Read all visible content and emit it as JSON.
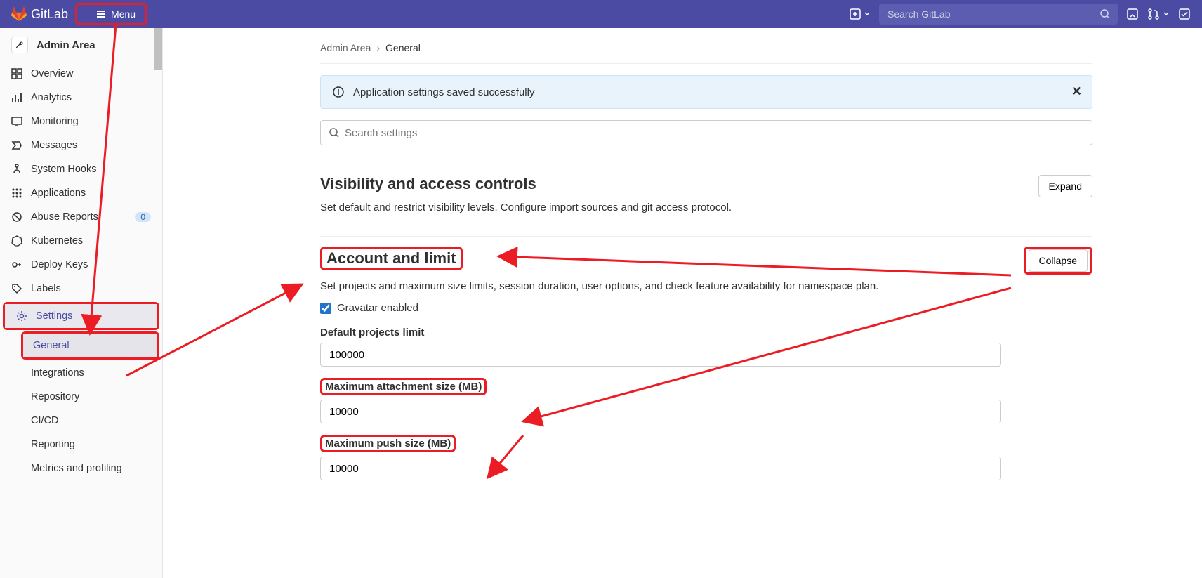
{
  "navbar": {
    "brand": "GitLab",
    "menu_label": "Menu",
    "search_placeholder": "Search GitLab"
  },
  "sidebar": {
    "title": "Admin Area",
    "items": [
      {
        "label": "Overview",
        "icon": "overview"
      },
      {
        "label": "Analytics",
        "icon": "analytics"
      },
      {
        "label": "Monitoring",
        "icon": "monitoring"
      },
      {
        "label": "Messages",
        "icon": "messages"
      },
      {
        "label": "System Hooks",
        "icon": "hooks"
      },
      {
        "label": "Applications",
        "icon": "applications"
      },
      {
        "label": "Abuse Reports",
        "icon": "abuse",
        "badge": "0"
      },
      {
        "label": "Kubernetes",
        "icon": "kubernetes"
      },
      {
        "label": "Deploy Keys",
        "icon": "deploykeys"
      },
      {
        "label": "Labels",
        "icon": "labels"
      },
      {
        "label": "Settings",
        "icon": "settings",
        "active": true
      }
    ],
    "subitems": [
      {
        "label": "General",
        "active": true
      },
      {
        "label": "Integrations"
      },
      {
        "label": "Repository"
      },
      {
        "label": "CI/CD"
      },
      {
        "label": "Reporting"
      },
      {
        "label": "Metrics and profiling"
      }
    ]
  },
  "breadcrumb": {
    "parent": "Admin Area",
    "current": "General"
  },
  "alert": {
    "message": "Application settings saved successfully"
  },
  "search_settings_placeholder": "Search settings",
  "sections": {
    "visibility": {
      "title": "Visibility and access controls",
      "desc": "Set default and restrict visibility levels. Configure import sources and git access protocol.",
      "button": "Expand"
    },
    "account": {
      "title": "Account and limit",
      "desc": "Set projects and maximum size limits, session duration, user options, and check feature availability for namespace plan.",
      "button": "Collapse",
      "gravatar_label": "Gravatar enabled",
      "gravatar_checked": true,
      "fields": {
        "projects_limit_label": "Default projects limit",
        "projects_limit_value": "100000",
        "attachment_label": "Maximum attachment size (MB)",
        "attachment_value": "10000",
        "push_label": "Maximum push size (MB)",
        "push_value": "10000"
      }
    }
  }
}
